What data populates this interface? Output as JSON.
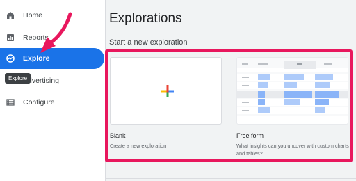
{
  "sidebar": {
    "items": [
      {
        "label": "Home",
        "icon": "home-icon"
      },
      {
        "label": "Reports",
        "icon": "bar-chart-icon"
      },
      {
        "label": "Explore",
        "icon": "explore-icon",
        "active": true
      },
      {
        "label": "Advertising",
        "icon": "advertising-icon"
      },
      {
        "label": "Configure",
        "icon": "list-icon"
      }
    ],
    "tooltip": "Explore"
  },
  "main": {
    "title": "Explorations",
    "subtitle": "Start a new exploration",
    "cards": [
      {
        "title": "Blank",
        "description": "Create a new exploration"
      },
      {
        "title": "Free form",
        "description": "What insights can you uncover with custom charts and tables?"
      }
    ]
  },
  "colors": {
    "accent": "#1a73e8",
    "highlight": "#e8175d"
  }
}
